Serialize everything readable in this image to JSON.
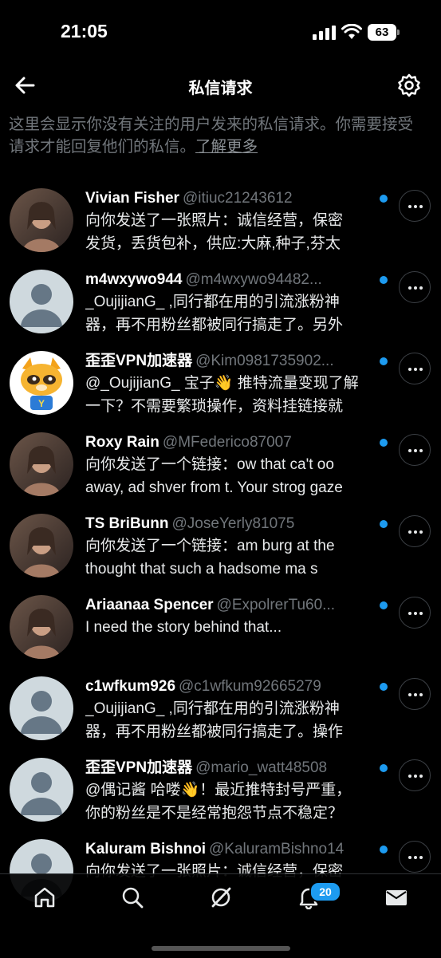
{
  "status_bar": {
    "time": "21:05",
    "battery": "63"
  },
  "header": {
    "title": "私信请求"
  },
  "info": {
    "text": "这里会显示你没有关注的用户发来的私信请求。你需要接受请求才能回复他们的私信。",
    "link": "了解更多"
  },
  "requests": [
    {
      "name": "Vivian Fisher",
      "handle": "@itiuc21243612",
      "line1": "向你发送了一张照片：诚信经营，保密",
      "line2": "发货，丢货包补，供应:大麻,种子,芬太",
      "avatar": "photo"
    },
    {
      "name": "m4wxywo944",
      "handle": "@m4wxywo94482...",
      "line1": "_OujijianG_ ,同行都在用的引流涨粉神",
      "line2": "器，再不用粉丝都被同行搞走了。另外",
      "avatar": "default"
    },
    {
      "name": "歪歪VPN加速器",
      "handle": "@Kim0981735902...",
      "line1": "@_OujijianG_ 宝子👋 推特流量变现了解",
      "line2": "一下？不需要繁琐操作，资料挂链接就",
      "avatar": "raccoon"
    },
    {
      "name": "Roxy Rain",
      "handle": "@MFederico87007",
      "line1": "向你发送了一个链接：ow that ca't oo",
      "line2": "away, ad  shver from t. Your strog gaze",
      "avatar": "photo"
    },
    {
      "name": "TS BriBunn",
      "handle": "@JoseYerly81075",
      "line1": "向你发送了一个链接：am burg at the",
      "line2": "thought that such a hadsome ma s",
      "avatar": "photo"
    },
    {
      "name": "Ariaanaa Spencer",
      "handle": "@ExpolrerTu60...",
      "line1": "I need the story behind that...",
      "line2": "",
      "avatar": "photo"
    },
    {
      "name": "c1wfkum926",
      "handle": "@c1wfkum92665279",
      "line1": "_OujijianG_ ,同行都在用的引流涨粉神",
      "line2": "器，再不用粉丝都被同行搞走了。操作",
      "avatar": "default"
    },
    {
      "name": "歪歪VPN加速器",
      "handle": "@mario_watt48508",
      "line1": "@偶记酱 哈喽👋！最近推特封号严重，",
      "line2": "你的粉丝是不是经常抱怨节点不稳定？",
      "avatar": "default"
    },
    {
      "name": "Kaluram Bishnoi",
      "handle": "@KaluramBishno14",
      "line1": "向你发送了一张照片：诚信经营，保密",
      "line2": "",
      "avatar": "default"
    }
  ],
  "tabs": [
    "home",
    "search",
    "grok",
    "notifications",
    "messages"
  ],
  "notifications_badge": "20",
  "colors": {
    "accent": "#1d9bf0",
    "background": "#000000",
    "secondary_text": "#71767b"
  }
}
